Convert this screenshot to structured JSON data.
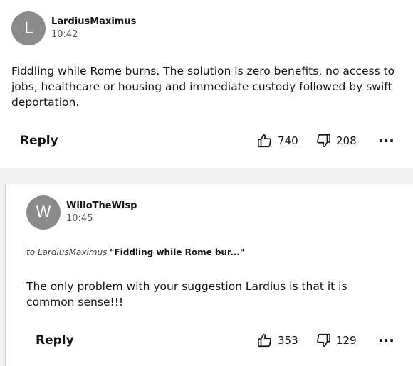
{
  "comments": [
    {
      "avatar_letter": "L",
      "username": "LardiusMaximus",
      "time": "10:42",
      "body": "Fiddling while Rome burns. The solution is zero benefits, no access to jobs, healthcare or housing and immediate custody followed by swift deportation.",
      "reply_label": "Reply",
      "likes": "740",
      "dislikes": "208",
      "more_label": "···"
    },
    {
      "avatar_letter": "W",
      "username": "WilloTheWisp",
      "time": "10:45",
      "reply_to_prefix": "to LardiusMaximus",
      "reply_to_quote": "\"Fiddling while Rome bur...\"",
      "body": "The only problem with your suggestion Lardius is that it is common sense!!!",
      "reply_label": "Reply",
      "likes": "353",
      "dislikes": "129",
      "more_label": "···"
    }
  ]
}
